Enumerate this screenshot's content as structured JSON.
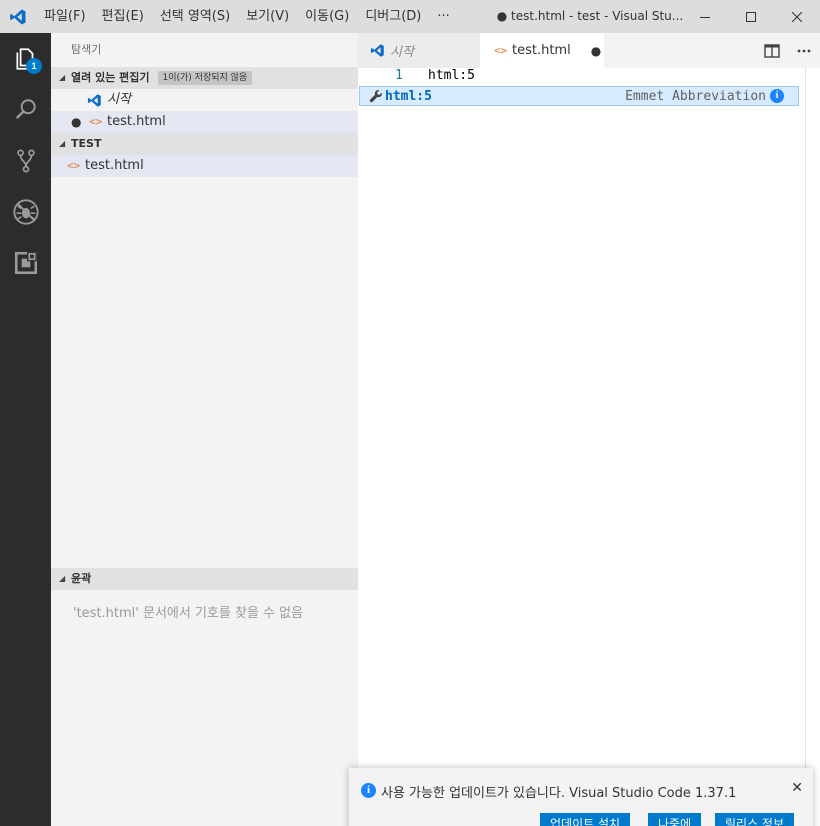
{
  "titlebar": {
    "menu": [
      "파일(F)",
      "편집(E)",
      "선택 영역(S)",
      "보기(V)",
      "이동(G)",
      "디버그(D)",
      "···"
    ],
    "window_title": "● test.html - test - Visual Stu..."
  },
  "activity": {
    "explorer_badge": "1"
  },
  "sidebar": {
    "title": "탐색기",
    "open_editors": {
      "header": "열려 있는 편집기",
      "unsaved_badge": "1이(가) 저장되지 않음",
      "items": [
        {
          "label": "시작"
        },
        {
          "dirty_marker": "●",
          "label": "test.html"
        }
      ]
    },
    "workspace": {
      "header": "TEST",
      "items": [
        {
          "label": "test.html"
        }
      ]
    },
    "outline": {
      "header": "윤곽",
      "message": "'test.html' 문서에서 기호를 찾을 수 없음"
    }
  },
  "tabs": [
    {
      "label": "시작",
      "active": false
    },
    {
      "label": "test.html",
      "active": true,
      "dirty_marker": "●"
    }
  ],
  "editor": {
    "line_number": "1",
    "code": "html:5",
    "suggestion": {
      "label": "html:5",
      "detail": "Emmet Abbreviation",
      "info_glyph": "i"
    }
  },
  "notification": {
    "info_glyph": "i",
    "message": "사용 가능한 업데이트가 있습니다. Visual Studio Code 1.37.1",
    "close_glyph": "✕",
    "buttons": [
      "업데이트 설치",
      "나중에",
      "릴리스 정보"
    ]
  },
  "colors": {
    "accent": "#007acc",
    "activitybar": "#2c2c2c",
    "sidebar": "#f3f3f3",
    "html_icon": "#e37933"
  }
}
